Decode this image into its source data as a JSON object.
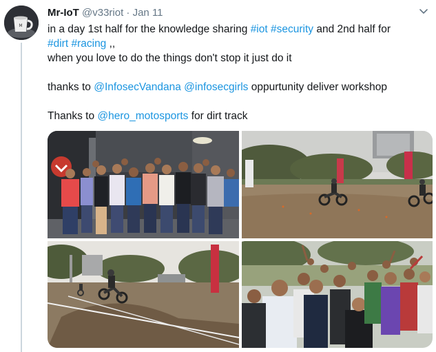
{
  "author": {
    "display_name": "Mr-IoT",
    "handle": "@v33riot",
    "separator": "·",
    "date": "Jan 11"
  },
  "tweet": {
    "line1": {
      "text1": "in a day 1st half for the knowledge sharing ",
      "tag_iot": "#iot",
      "space1": " ",
      "tag_security": "#security",
      "text2": " and 2nd half for"
    },
    "line2": {
      "tag_dirt": "#dirt",
      "space": " ",
      "tag_racing": "#racing",
      "text": " ,,"
    },
    "line3": "when you love to do the things don't stop it just do it",
    "line4": {
      "text1": "thanks to ",
      "mention1": "@InfosecVandana",
      "space": " ",
      "mention2": "@infosecgirls",
      "text2": " oppurtunity deliver workshop"
    },
    "line5": {
      "text1": "Thanks to ",
      "mention": "@hero_motosports",
      "text2": " for dirt track"
    }
  },
  "media": {
    "photo_count": 4,
    "photos": [
      "group-photo",
      "dirt-track-riders",
      "dirt-track-jump-rider",
      "crowd-selfie"
    ]
  },
  "icons": {
    "menu": "chevron-down-icon",
    "avatar": "avatar-cup-icon"
  },
  "colors": {
    "link": "#1b95e0",
    "text": "#14171a",
    "secondary": "#657786",
    "thread_line": "#ccd6dd"
  }
}
